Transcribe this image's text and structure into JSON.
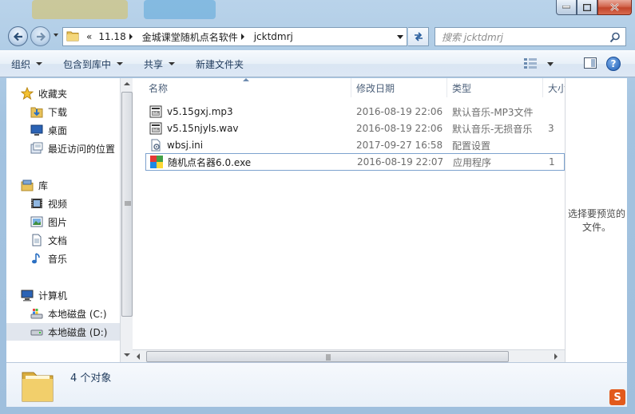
{
  "address": {
    "overflow": "«",
    "crumbs": [
      "11.18",
      "金城课堂随机点名软件",
      "jcktdmrj"
    ]
  },
  "search": {
    "placeholder": "搜索 jcktdmrj"
  },
  "commands": {
    "organize": "组织",
    "include_in_library": "包含到库中",
    "share": "共享",
    "new_folder": "新建文件夹",
    "help": "?"
  },
  "nav": {
    "favorites": "收藏夹",
    "downloads": "下载",
    "desktop": "桌面",
    "recent": "最近访问的位置",
    "libraries": "库",
    "videos": "视频",
    "pictures": "图片",
    "documents": "文档",
    "music": "音乐",
    "computer": "计算机",
    "drive_c": "本地磁盘 (C:)",
    "drive_d": "本地磁盘 (D:)"
  },
  "columns": {
    "name": "名称",
    "modified": "修改日期",
    "type": "类型",
    "size": "大小"
  },
  "files": [
    {
      "name": "v5.15gxj.mp3",
      "modified": "2016-08-19 22:06",
      "type": "默认音乐-MP3文件",
      "size": "",
      "icon": "audio-file-icon"
    },
    {
      "name": "v5.15njyls.wav",
      "modified": "2016-08-19 22:06",
      "type": "默认音乐-无损音乐",
      "size": "3",
      "icon": "audio-file-icon"
    },
    {
      "name": "wbsj.ini",
      "modified": "2017-09-27 16:58",
      "type": "配置设置",
      "size": "",
      "icon": "ini-file-icon"
    },
    {
      "name": "随机点名器6.0.exe",
      "modified": "2016-08-19 22:07",
      "type": "应用程序",
      "size": "1",
      "icon": "app-icon"
    }
  ],
  "preview": {
    "message": "选择要预览的文件。"
  },
  "details": {
    "count": "4 个对象"
  },
  "colors": {
    "accent": "#1e395b",
    "selection_border": "#7da2ce",
    "window_frame": "#a3c3e0"
  }
}
